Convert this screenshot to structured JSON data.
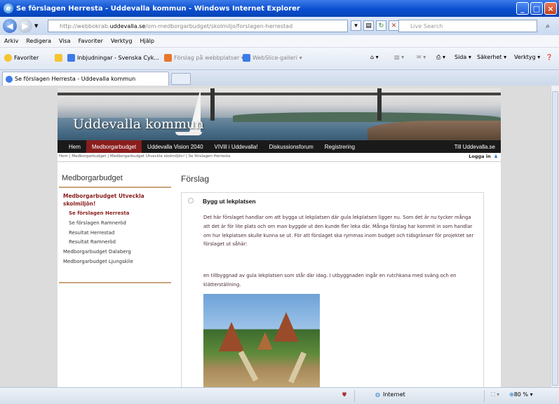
{
  "window": {
    "title": "Se förslagen Herresta - Uddevalla kommun - Windows Internet Explorer",
    "minimize": "_",
    "maximize": "□",
    "close": "×"
  },
  "address": {
    "url_prefix": "http://webbokrab.",
    "url_domain": "uddevalla.se",
    "url_path": "/om-medborgarbudget/skolmiljo/forslagen-herrestad",
    "search_placeholder": "Live Search"
  },
  "menu": [
    "Arkiv",
    "Redigera",
    "Visa",
    "Favoriter",
    "Verktyg",
    "Hjälp"
  ],
  "favorites": {
    "favorites_label": "Favoriter",
    "link1": "Inbjudningar - Svenska Cyk...",
    "link2": "Förslag på webbplatser",
    "link3": "WebSlice-galleri",
    "tool_sida": "Sida",
    "tool_sakerhet": "Säkerhet",
    "tool_verktyg": "Verktyg"
  },
  "tab": {
    "label": "Se förslagen Herresta - Uddevalla kommun"
  },
  "site": {
    "title": "Uddevalla kommun",
    "nav": [
      "Hem",
      "Medborgarbudget",
      "Uddevalla Vision 2040",
      "VIVill i Uddevalla!",
      "Diskussionsforum",
      "Registrering"
    ],
    "nav_right": "Till Uddevalla.se",
    "breadcrumb": "Hem | Medborgarbudget | Medborgarbudget Utveckla skolmiljön! | Se förslagen Herresta",
    "login": "Logga in"
  },
  "sidebar": {
    "heading": "Medborgarbudget",
    "section": "Medborgarbudget Utveckla skolmiljön!",
    "items": [
      "Se förslagen Herresta",
      "Se förslagen Ramneröd",
      "Resultat Herrestad",
      "Resultat Ramneröd"
    ],
    "extra": [
      "Medborgarbudget Dalaberg",
      "Medborgarbudget Ljungskile"
    ]
  },
  "main": {
    "heading": "Förslag",
    "proposal_title": "Bygg ut lekplatsen",
    "paragraph1": "Det här förslaget handlar om att bygga ut lekplatsen där gula lekplatsen ligger nu. Som det är nu tycker många att det är för lite plats och om man byggde ut den kunde fler leka där. Många förslag har kommit in som handlar om hur lekplatsen skulle kunna se ut. För att förslaget ska rymmas inom budget och tidsgränser för projektet ser förslaget ut såhär:",
    "paragraph2": "en tillbyggnad av gula lekplatsen som står där idag. I utbyggnaden ingår en rutchkana med sväng och en klätterställning."
  },
  "status": {
    "zone": "Internet",
    "zoom": "80 %"
  }
}
